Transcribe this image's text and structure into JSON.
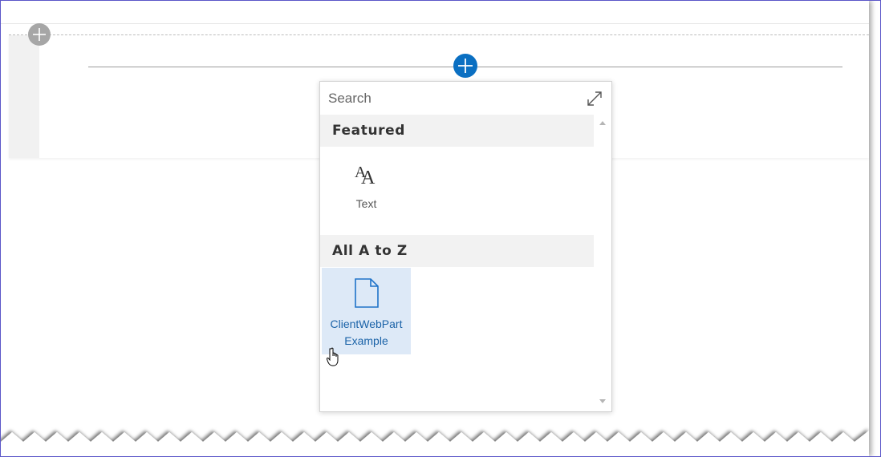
{
  "toolbox": {
    "search": {
      "placeholder": "Search",
      "value": ""
    },
    "groups": [
      {
        "title": "Featured",
        "items": [
          {
            "label": "Text",
            "icon": "text-icon",
            "selected": false
          }
        ]
      },
      {
        "title": "All A to Z",
        "items": [
          {
            "label_line1": "ClientWebPart",
            "label_line2": "Example",
            "icon": "document-icon",
            "selected": true
          }
        ]
      }
    ]
  },
  "colors": {
    "accent": "#0a6fc2",
    "selected_tile_bg": "#dde9f7",
    "selected_tile_text": "#1b63a8",
    "group_header_bg": "#f2f2f2",
    "add_section_btn": "#a6a6a6"
  }
}
